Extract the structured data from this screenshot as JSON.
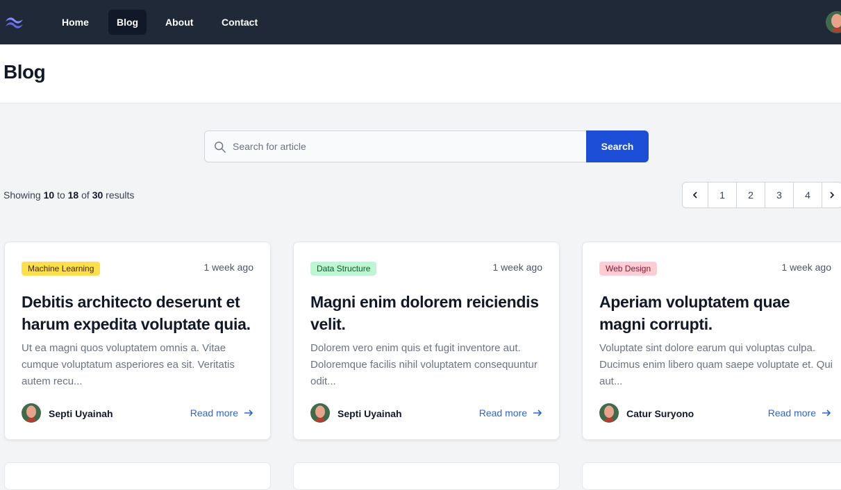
{
  "nav": {
    "items": [
      {
        "label": "Home"
      },
      {
        "label": "Blog"
      },
      {
        "label": "About"
      },
      {
        "label": "Contact"
      }
    ],
    "active_index": 1
  },
  "header": {
    "title": "Blog"
  },
  "search": {
    "placeholder": "Search for article",
    "value": "",
    "button_label": "Search"
  },
  "results": {
    "prefix": "Showing",
    "from": "10",
    "to_word": "to",
    "to": "18",
    "of_word": "of",
    "total": "30",
    "suffix": "results"
  },
  "pagination": {
    "pages": [
      "1",
      "2",
      "3",
      "4"
    ]
  },
  "cards": [
    {
      "category": "Machine Learning",
      "time": "1 week ago",
      "title": "Debitis architecto deserunt et harum expedita voluptate quia.",
      "excerpt": "Ut ea magni quos voluptatem omnis a. Vitae cumque voluptatum asperiores ea sit. Veritatis autem recu...",
      "author": "Septi Uyainah",
      "read_more": "Read more"
    },
    {
      "category": "Data Structure",
      "time": "1 week ago",
      "title": "Magni enim dolorem reiciendis velit.",
      "excerpt": "Dolorem vero enim quis et fugit inventore aut. Doloremque facilis nihil voluptatem consequuntur odit...",
      "author": "Septi Uyainah",
      "read_more": "Read more"
    },
    {
      "category": "Web Design",
      "time": "1 week ago",
      "title": "Aperiam voluptatem quae magni corrupti.",
      "excerpt": "Voluptate sint dolore earum qui voluptas culpa. Ducimus enim libero quam saepe voluptate et. Qui aut...",
      "author": "Catur Suryono",
      "read_more": "Read more"
    }
  ],
  "colors": {
    "navbar_bg": "#1f2937",
    "accent": "#1d4ed8",
    "link": "#2563eb",
    "badge_machine_learning": "#fde047",
    "badge_data_structure": "#bbf7d0",
    "badge_web_design": "#fecdd3"
  },
  "icons": [
    "logo-icon",
    "avatar",
    "search-icon",
    "chevron-left-icon",
    "chevron-right-icon",
    "arrow-right-icon"
  ]
}
